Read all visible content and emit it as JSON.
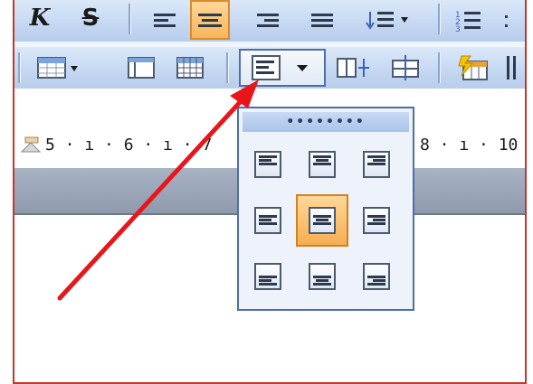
{
  "ruler": {
    "left_text": "5 · ı · 6 · ı · 7",
    "right_text": "8 · ı · 10"
  },
  "popup": {
    "grip_label": "••••••••",
    "cells": [
      {
        "name": "top-left",
        "h": "left",
        "v": "top",
        "selected": false
      },
      {
        "name": "top-center",
        "h": "center",
        "v": "top",
        "selected": false
      },
      {
        "name": "top-right",
        "h": "right",
        "v": "top",
        "selected": false
      },
      {
        "name": "middle-left",
        "h": "left",
        "v": "middle",
        "selected": false
      },
      {
        "name": "middle-center",
        "h": "center",
        "v": "middle",
        "selected": true
      },
      {
        "name": "middle-right",
        "h": "right",
        "v": "middle",
        "selected": false
      },
      {
        "name": "bottom-left",
        "h": "left",
        "v": "bottom",
        "selected": false
      },
      {
        "name": "bottom-center",
        "h": "center",
        "v": "bottom",
        "selected": false
      },
      {
        "name": "bottom-right",
        "h": "right",
        "v": "bottom",
        "selected": false
      }
    ]
  },
  "toolbar1": {
    "italic_label": "K",
    "strike_label": "S",
    "dropdown_glyph": "▾"
  },
  "colors": {
    "accent_orange": "#f8b55b",
    "arrow_red": "#e8161b",
    "popup_border": "#4b6fa8"
  },
  "icons": [
    "align-left-icon",
    "align-center-icon",
    "align-right-icon",
    "justify-icon",
    "line-spacing-icon",
    "numbered-list-icon",
    "table-icon",
    "table-borders-icon",
    "insert-table-icon",
    "cell-alignment-icon",
    "distribute-columns-icon",
    "distribute-rows-icon",
    "autoformat-icon",
    "text-direction-icon"
  ]
}
